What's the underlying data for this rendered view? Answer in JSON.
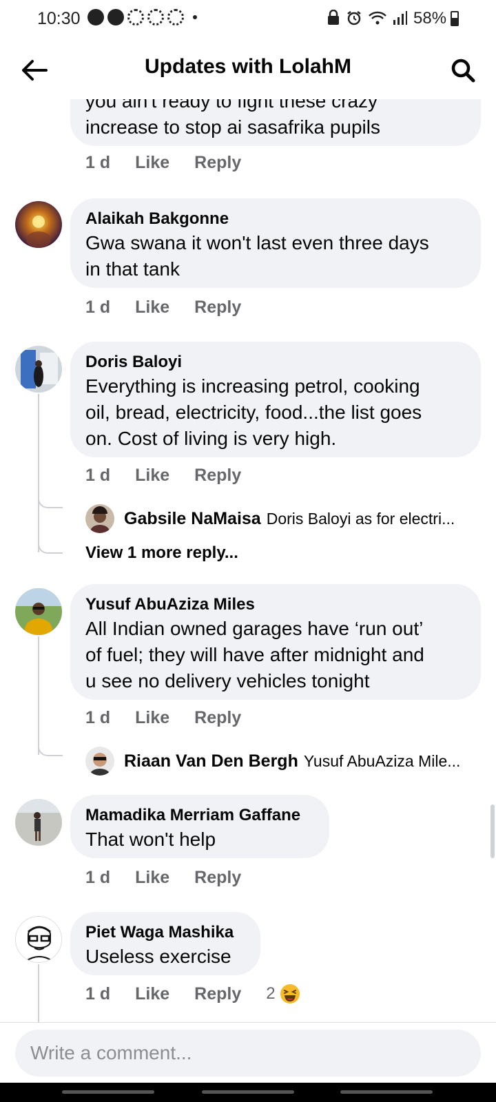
{
  "status_bar": {
    "time": "10:30",
    "battery": "58%",
    "notification_icons": [
      "messenger-icon",
      "messenger-icon",
      "recycle-icon",
      "recycle-icon",
      "recycle-icon"
    ],
    "right_icons": [
      "lock-icon",
      "alarm-icon",
      "wifi-icon",
      "signal-icon",
      "battery-icon"
    ]
  },
  "header": {
    "title": "Updates with LolahM",
    "back_icon": "arrow-left-icon",
    "search_icon": "search-icon"
  },
  "comments": [
    {
      "text_lines": [
        "you ain't ready to fight these crazy",
        "increase to stop ai sasafrika pupils"
      ],
      "time": "1 d",
      "like": "Like",
      "reply": "Reply"
    },
    {
      "author": "Alaikah Bakgonne",
      "text_lines": [
        "Gwa swana it won't last even three days",
        "in that tank"
      ],
      "time": "1 d",
      "like": "Like",
      "reply": "Reply"
    },
    {
      "author": "Doris Baloyi",
      "text_lines": [
        "Everything is increasing petrol, cooking",
        "oil, bread, electricity, food...the list goes",
        "on. Cost of living is very high."
      ],
      "time": "1 d",
      "like": "Like",
      "reply": "Reply",
      "reply_preview": {
        "name": "Gabsile NaMaisa",
        "text": "Doris Baloyi as for electri..."
      },
      "view_more": "View 1 more reply..."
    },
    {
      "author": "Yusuf AbuAziza Miles",
      "text_lines": [
        "All Indian owned garages have ‘run out’",
        "of fuel; they will have after midnight and",
        "u see no delivery vehicles tonight"
      ],
      "time": "1 d",
      "like": "Like",
      "reply": "Reply",
      "reply_preview": {
        "name": "Riaan Van Den Bergh",
        "text": "Yusuf AbuAziza Mile..."
      }
    },
    {
      "author": "Mamadika Merriam Gaffane",
      "text_lines": [
        "That won't help"
      ],
      "time": "1 d",
      "like": "Like",
      "reply": "Reply"
    },
    {
      "author": "Piet Waga Mashika",
      "text_lines": [
        "Useless exercise"
      ],
      "time": "1 d",
      "like": "Like",
      "reply": "Reply",
      "reaction_count": "2",
      "reaction_icon": "laughing-emoji-icon"
    }
  ],
  "composer": {
    "placeholder": "Write a comment..."
  }
}
